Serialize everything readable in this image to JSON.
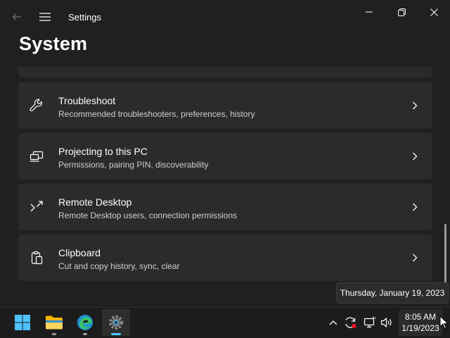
{
  "window": {
    "title": "Settings",
    "page_title": "System",
    "controls": [
      "minimize",
      "maximize",
      "close"
    ]
  },
  "cards": [
    {
      "icon": "wrench-icon",
      "title": "Troubleshoot",
      "description": "Recommended troubleshooters, preferences, history"
    },
    {
      "icon": "projector-icon",
      "title": "Projecting to this PC",
      "description": "Permissions, pairing PIN, discoverability"
    },
    {
      "icon": "remote-desktop-icon",
      "title": "Remote Desktop",
      "description": "Remote Desktop users, connection permissions"
    },
    {
      "icon": "clipboard-icon",
      "title": "Clipboard",
      "description": "Cut and copy history, sync, clear"
    }
  ],
  "tooltip": {
    "text": "Thursday, January 19, 2023"
  },
  "taskbar": {
    "apps": [
      "start",
      "file-explorer",
      "edge",
      "settings"
    ],
    "active_app": "settings",
    "tray": [
      "chevron-up-icon",
      "sync-icon",
      "network-icon",
      "volume-icon"
    ],
    "clock": {
      "time": "8:05 AM",
      "date": "1/19/2023"
    }
  },
  "colors": {
    "background": "#202020",
    "card": "#2b2b2b",
    "taskbar": "#1c1c1c",
    "accent": "#4cc2ff",
    "alert": "#e81123"
  }
}
